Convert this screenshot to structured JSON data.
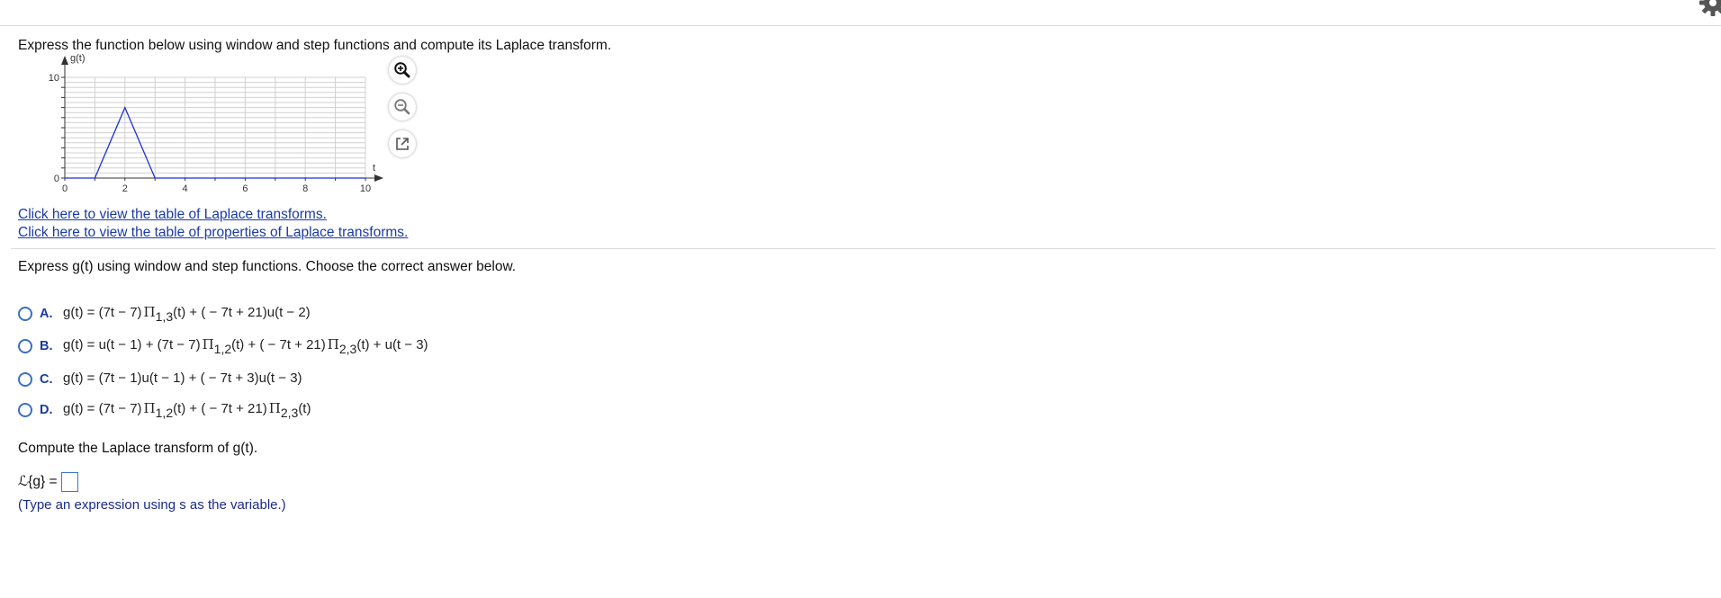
{
  "question": {
    "instruction": "Express the function below using window and step functions and compute its Laplace transform.",
    "link_table": "Click here to view the table of Laplace transforms.",
    "link_properties": "Click here to view the table of properties of Laplace transforms."
  },
  "graph": {
    "y_label": "g(t)",
    "x_label": "t",
    "y_ticks": [
      "10",
      "0"
    ],
    "x_ticks": [
      "0",
      "2",
      "4",
      "6",
      "8",
      "10"
    ],
    "xlim": [
      0,
      10
    ],
    "ylim": [
      0,
      10
    ],
    "series": [
      {
        "x": [
          0,
          1,
          2,
          3,
          10
        ],
        "y": [
          0,
          0,
          7,
          0,
          0
        ]
      }
    ],
    "line_color": "#1f2fd6"
  },
  "tools": {
    "zoom_in": "zoom-in-icon",
    "zoom_out": "zoom-out-icon",
    "popout": "popout-icon"
  },
  "part1": {
    "prompt": "Express g(t) using window and step functions. Choose the correct answer below.",
    "options": [
      {
        "letter": "A.",
        "pre": "g(t) = (7t − 7)",
        "pi1": "Π",
        "sub1": "1,3",
        "mid": "(t) + ( − 7t + 21)u(t − 2)",
        "pi2": "",
        "sub2": "",
        "post": ""
      },
      {
        "letter": "B.",
        "pre": "g(t) = u(t − 1) + (7t − 7)",
        "pi1": "Π",
        "sub1": "1,2",
        "mid": "(t) + ( − 7t + 21)",
        "pi2": "Π",
        "sub2": "2,3",
        "post": "(t) + u(t − 3)"
      },
      {
        "letter": "C.",
        "pre": "g(t) = (7t − 1)u(t − 1) + ( − 7t + 3)u(t − 3)",
        "pi1": "",
        "sub1": "",
        "mid": "",
        "pi2": "",
        "sub2": "",
        "post": ""
      },
      {
        "letter": "D.",
        "pre": "g(t) = (7t − 7)",
        "pi1": "Π",
        "sub1": "1,2",
        "mid": "(t) + ( − 7t + 21)",
        "pi2": "Π",
        "sub2": "2,3",
        "post": "(t)"
      }
    ]
  },
  "part2": {
    "prompt": "Compute the Laplace transform of g(t).",
    "answer_label": "ℒ{g} =",
    "answer_value": "",
    "hint": "(Type an expression using s as the variable.)"
  },
  "colors": {
    "link": "#1a3aa8",
    "radio": "#3b6fc4",
    "answer_box": "#3b78d4"
  }
}
